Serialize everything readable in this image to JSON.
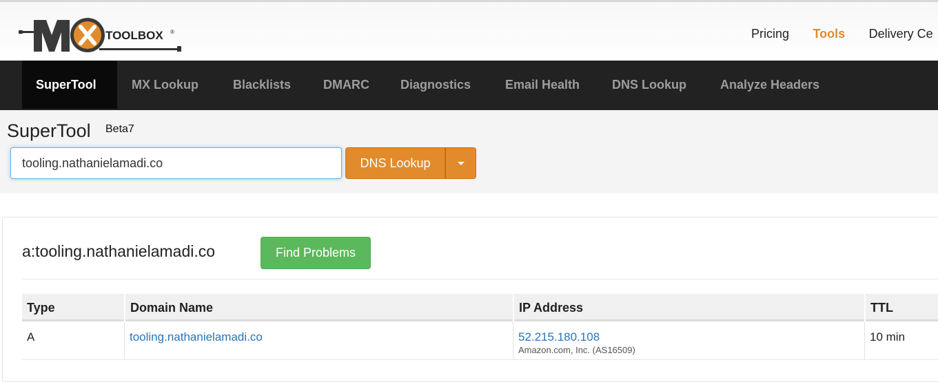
{
  "brand": {
    "logo_text": "MX TOOLBOX",
    "accent_color": "#e28b2c"
  },
  "top_nav": [
    "Pricing",
    "Tools",
    "Delivery Ce"
  ],
  "main_nav": [
    "SuperTool",
    "MX Lookup",
    "Blacklists",
    "DMARC",
    "Diagnostics",
    "Email Health",
    "DNS Lookup",
    "Analyze Headers"
  ],
  "supertool": {
    "title": "SuperTool",
    "beta": "Beta7",
    "input_value": "tooling.nathanielamadi.co",
    "button_label": "DNS Lookup"
  },
  "result": {
    "title": "a:tooling.nathanielamadi.co",
    "find_problems_label": "Find Problems",
    "columns": [
      "Type",
      "Domain Name",
      "IP Address",
      "TTL"
    ],
    "rows": [
      {
        "type": "A",
        "domain": "tooling.nathanielamadi.co",
        "ip": "52.215.180.108",
        "ip_owner": "Amazon.com, Inc. (AS16509)",
        "ttl": "10 min"
      }
    ]
  }
}
